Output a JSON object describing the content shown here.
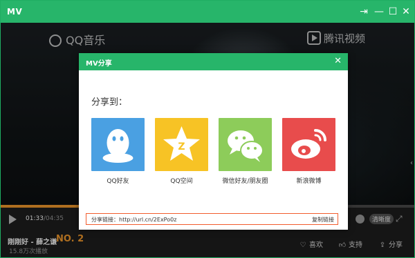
{
  "window": {
    "title": "MV",
    "buttons": {
      "pin": "⇥",
      "minimize": "—",
      "maximize": "☐",
      "close": "✕"
    }
  },
  "video": {
    "watermark_left": "QQ音乐",
    "watermark_right": "腾讯视频"
  },
  "player": {
    "current_time": "01:33",
    "separator": "/",
    "duration": "04:35",
    "progress_fraction": 0.339,
    "quality_label": "清晰度",
    "song": "刚刚好 - 薛之谦",
    "rank": "NO. 2",
    "play_count": "15.8万次播放",
    "actions": {
      "like": "喜欢",
      "support": "支持",
      "share": "分享"
    }
  },
  "dialog": {
    "title": "MV分享",
    "close": "✕",
    "share_to": "分享到：",
    "targets": [
      {
        "label": "QQ好友",
        "icon": "qq-penguin-icon",
        "color": "#4aa0e2"
      },
      {
        "label": "QQ空间",
        "icon": "qzone-star-icon",
        "color": "#f7c325"
      },
      {
        "label": "微信好友/朋友圈",
        "icon": "wechat-icon",
        "color": "#8dcc5a"
      },
      {
        "label": "新浪微博",
        "icon": "weibo-icon",
        "color": "#e84c4c"
      }
    ],
    "link_text": "分享链接：http://url.cn/2ExPo0z",
    "copy_label": "复制链接"
  }
}
